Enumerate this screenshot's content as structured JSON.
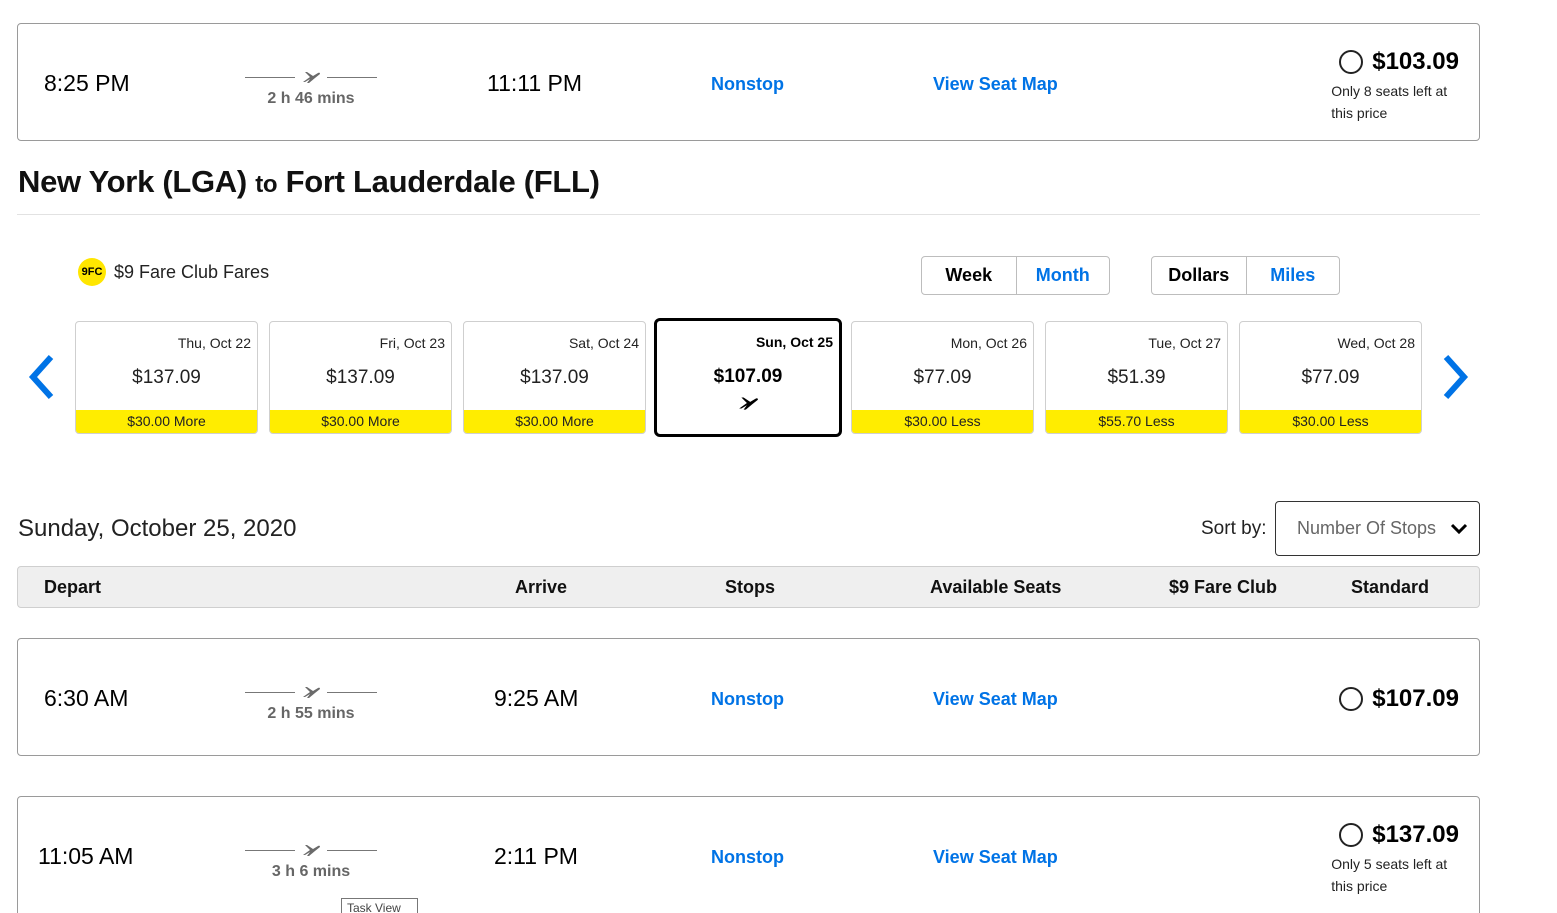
{
  "flights_prev": [
    {
      "depart": "8:25 PM",
      "duration": "2 h 46 mins",
      "arrive": "11:11 PM",
      "stops": "Nonstop",
      "seat_map": "View Seat Map",
      "price": "$103.09",
      "seats_note": "Only 8 seats left at this price"
    }
  ],
  "route": {
    "from": "New York (LGA)",
    "to_word": "to",
    "to": "Fort Lauderdale (FLL)"
  },
  "fare_club": {
    "badge": "9FC",
    "label": "$9 Fare Club Fares"
  },
  "view_toggle": {
    "week": "Week",
    "month": "Month",
    "selected": "Week"
  },
  "currency_toggle": {
    "dollars": "Dollars",
    "miles": "Miles",
    "selected": "Dollars"
  },
  "calendar": [
    {
      "date": "Thu, Oct 22",
      "price": "$137.09",
      "diff": "$30.00 More"
    },
    {
      "date": "Fri, Oct 23",
      "price": "$137.09",
      "diff": "$30.00 More"
    },
    {
      "date": "Sat, Oct 24",
      "price": "$137.09",
      "diff": "$30.00 More"
    },
    {
      "date": "Sun, Oct 25",
      "price": "$107.09",
      "diff": "",
      "selected": true
    },
    {
      "date": "Mon, Oct 26",
      "price": "$77.09",
      "diff": "$30.00 Less"
    },
    {
      "date": "Tue, Oct 27",
      "price": "$51.39",
      "diff": "$55.70 Less"
    },
    {
      "date": "Wed, Oct 28",
      "price": "$77.09",
      "diff": "$30.00 Less"
    }
  ],
  "results": {
    "date_heading": "Sunday, October 25, 2020",
    "sort_label": "Sort by:",
    "sort_value": "Number Of Stops",
    "columns": {
      "depart": "Depart",
      "arrive": "Arrive",
      "stops": "Stops",
      "seats": "Available Seats",
      "fare_club": "$9 Fare Club",
      "standard": "Standard"
    },
    "flights": [
      {
        "depart": "6:30 AM",
        "duration": "2 h 55 mins",
        "arrive": "9:25 AM",
        "stops": "Nonstop",
        "seat_map": "View Seat Map",
        "price": "$107.09",
        "seats_note": ""
      },
      {
        "depart": "11:05 AM",
        "duration": "3 h 6 mins",
        "arrive": "2:11 PM",
        "stops": "Nonstop",
        "seat_map": "View Seat Map",
        "price": "$137.09",
        "seats_note": "Only 5 seats left at this price"
      }
    ]
  },
  "taskbar_tooltip": "Task View",
  "colors": {
    "link": "#0073e6",
    "fare_yellow": "#ffed00",
    "badge_yellow": "#ffe600"
  }
}
